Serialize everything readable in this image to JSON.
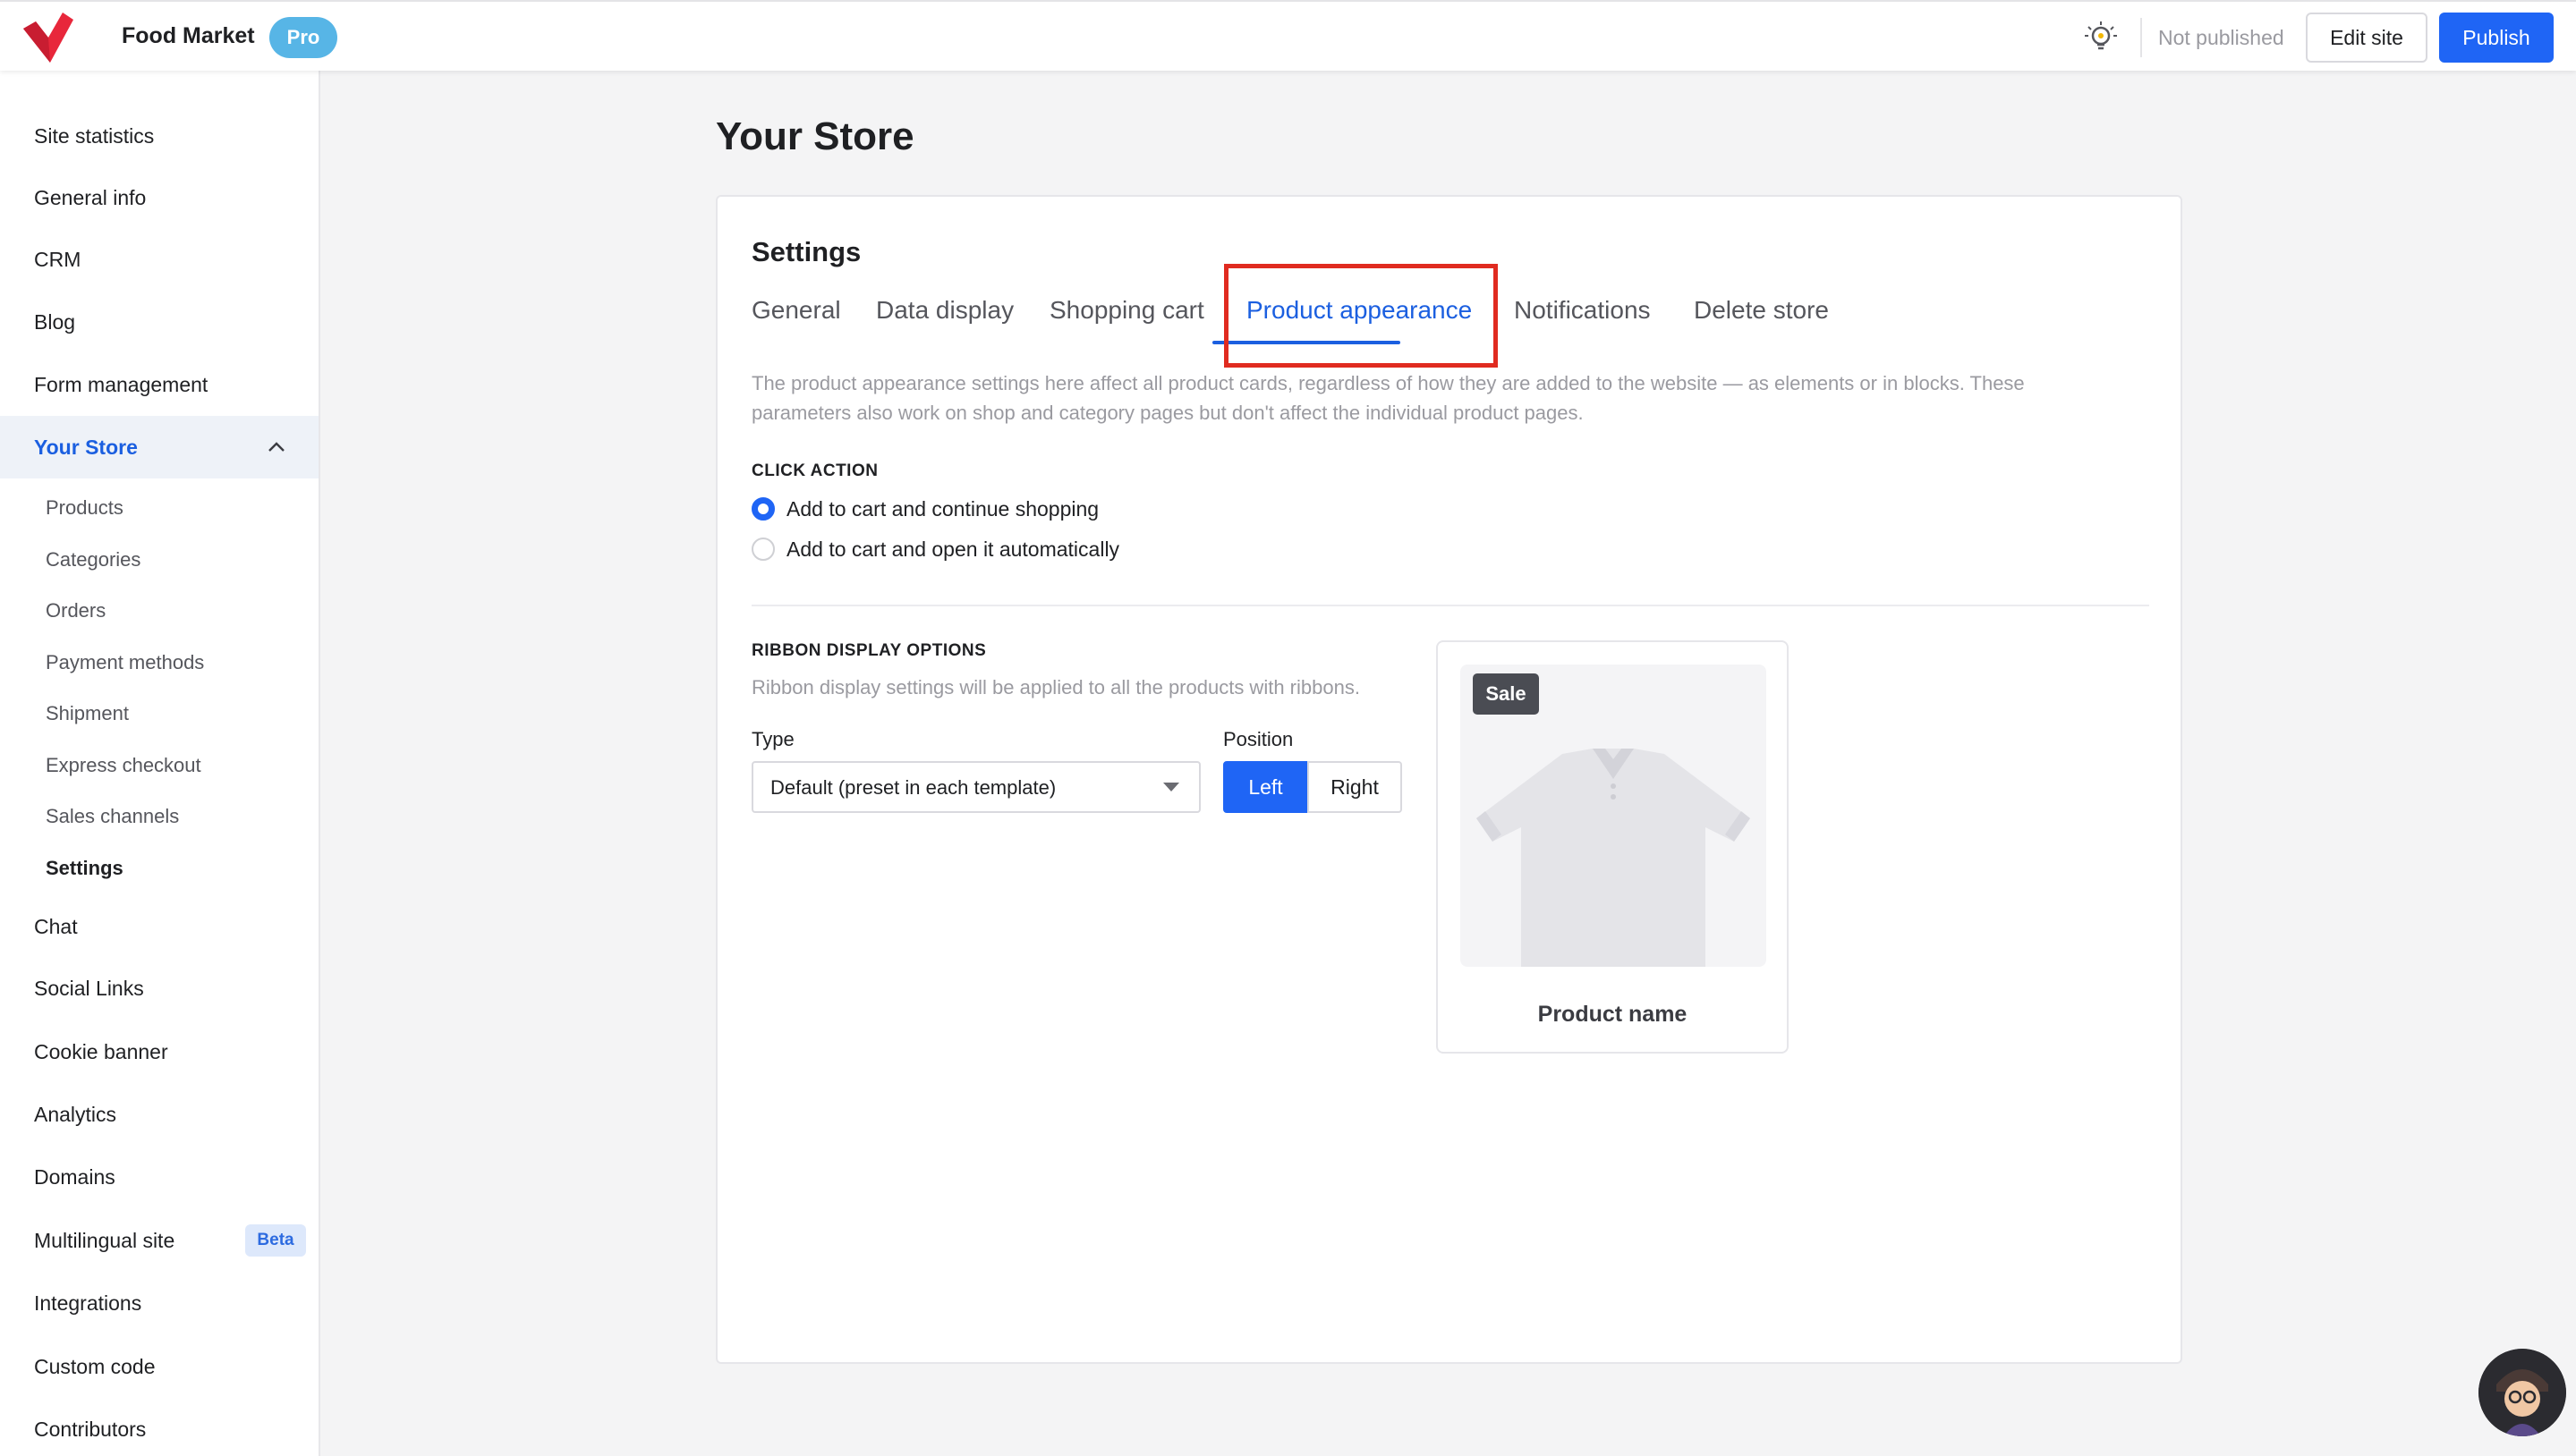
{
  "header": {
    "site_name": "Food Market",
    "plan_badge": "Pro",
    "status": "Not published",
    "edit_site_label": "Edit site",
    "publish_label": "Publish"
  },
  "sidebar": {
    "items_top": [
      {
        "label": "Site statistics"
      },
      {
        "label": "General info"
      },
      {
        "label": "CRM"
      },
      {
        "label": "Blog"
      },
      {
        "label": "Form management"
      }
    ],
    "store_section": {
      "label": "Your Store",
      "subitems": [
        {
          "label": "Products"
        },
        {
          "label": "Categories"
        },
        {
          "label": "Orders"
        },
        {
          "label": "Payment methods"
        },
        {
          "label": "Shipment"
        },
        {
          "label": "Express checkout"
        },
        {
          "label": "Sales channels"
        },
        {
          "label": "Settings"
        }
      ]
    },
    "items_bottom": [
      {
        "label": "Chat"
      },
      {
        "label": "Social Links"
      },
      {
        "label": "Cookie banner"
      },
      {
        "label": "Analytics"
      },
      {
        "label": "Domains"
      },
      {
        "label": "Multilingual site",
        "badge": "Beta"
      },
      {
        "label": "Integrations"
      },
      {
        "label": "Custom code"
      },
      {
        "label": "Contributors"
      }
    ]
  },
  "main": {
    "page_title": "Your Store",
    "card_title": "Settings",
    "tabs": [
      {
        "label": "General"
      },
      {
        "label": "Data display"
      },
      {
        "label": "Shopping cart"
      },
      {
        "label": "Product appearance"
      },
      {
        "label": "Notifications"
      },
      {
        "label": "Delete store"
      }
    ],
    "active_tab": "Product appearance",
    "description": "The product appearance settings here affect all product cards, regardless of how they are added to the website — as elements or in blocks. These parameters also work on shop and category pages but don't affect the individual product pages.",
    "click_action": {
      "heading": "CLICK ACTION",
      "options": [
        {
          "label": "Add to cart and continue shopping",
          "selected": true
        },
        {
          "label": "Add to cart and open it automatically",
          "selected": false
        }
      ]
    },
    "ribbon": {
      "heading": "RIBBON DISPLAY OPTIONS",
      "hint": "Ribbon display settings will be applied to all the products with ribbons.",
      "type_label": "Type",
      "type_value": "Default (preset in each template)",
      "position_label": "Position",
      "position_options": [
        "Left",
        "Right"
      ],
      "position_selected": "Left"
    },
    "preview": {
      "badge": "Sale",
      "product_name": "Product name"
    }
  },
  "colors": {
    "accent": "#1f65f5",
    "active_text": "#1b5fe0",
    "highlight": "#e02b20",
    "logo": "#e8273b",
    "pro_badge": "#57b5e6"
  }
}
